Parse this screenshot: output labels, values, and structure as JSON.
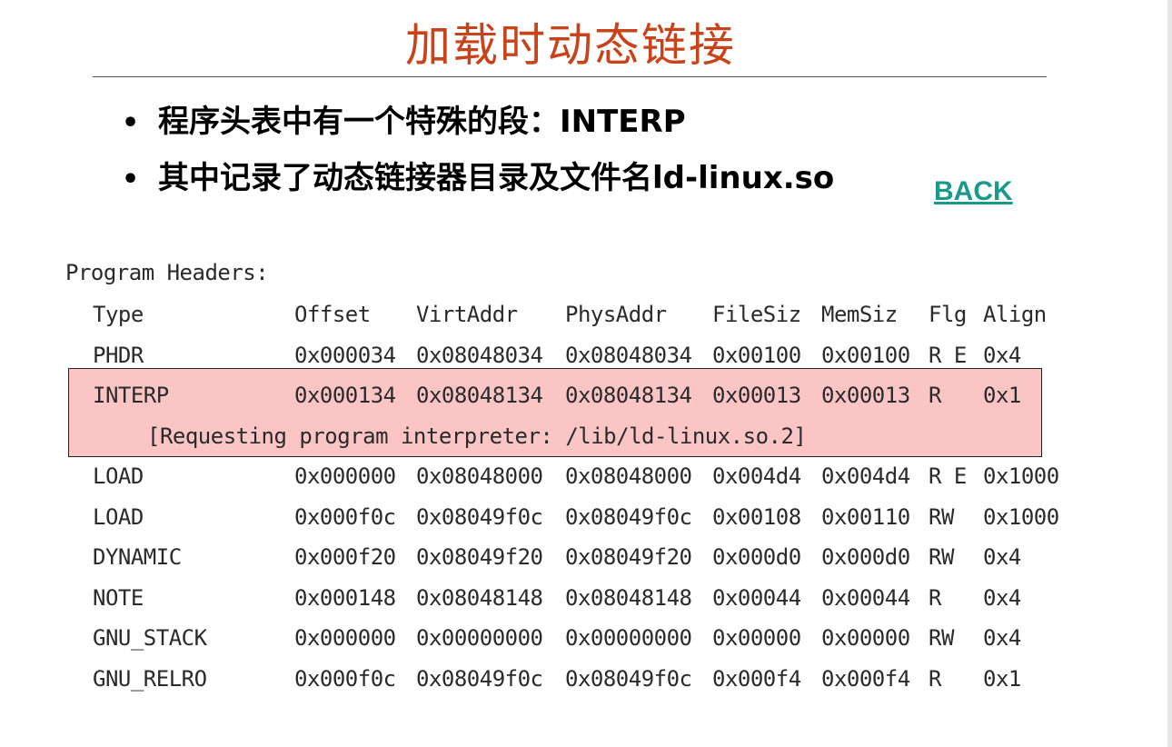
{
  "slide": {
    "title": "加载时动态链接",
    "bullets": [
      "程序头表中有一个特殊的段：INTERP",
      "其中记录了动态链接器目录及文件名ld-linux.so"
    ],
    "back_label": "BACK",
    "title_color": "#c8421a",
    "link_color": "#1a9a8a",
    "highlight_color": "#fbc5c5"
  },
  "program_headers": {
    "heading": "Program Headers:",
    "columns": [
      "Type",
      "Offset",
      "VirtAddr",
      "PhysAddr",
      "FileSiz",
      "MemSiz",
      "Flg",
      "Align"
    ],
    "rows": [
      [
        "PHDR",
        "0x000034",
        "0x08048034",
        "0x08048034",
        "0x00100",
        "0x00100",
        "R E",
        "0x4"
      ],
      [
        "INTERP",
        "0x000134",
        "0x08048134",
        "0x08048134",
        "0x00013",
        "0x00013",
        "R",
        "0x1"
      ],
      [
        "LOAD",
        "0x000000",
        "0x08048000",
        "0x08048000",
        "0x004d4",
        "0x004d4",
        "R E",
        "0x1000"
      ],
      [
        "LOAD",
        "0x000f0c",
        "0x08049f0c",
        "0x08049f0c",
        "0x00108",
        "0x00110",
        "RW",
        "0x1000"
      ],
      [
        "DYNAMIC",
        "0x000f20",
        "0x08049f20",
        "0x08049f20",
        "0x000d0",
        "0x000d0",
        "RW",
        "0x4"
      ],
      [
        "NOTE",
        "0x000148",
        "0x08048148",
        "0x08048148",
        "0x00044",
        "0x00044",
        "R",
        "0x4"
      ],
      [
        "GNU_STACK",
        "0x000000",
        "0x00000000",
        "0x00000000",
        "0x00000",
        "0x00000",
        "RW",
        "0x4"
      ],
      [
        "GNU_RELRO",
        "0x000f0c",
        "0x08049f0c",
        "0x08049f0c",
        "0x000f4",
        "0x000f4",
        "R",
        "0x1"
      ]
    ],
    "interp_note": "[Requesting program interpreter: /lib/ld-linux.so.2]"
  }
}
